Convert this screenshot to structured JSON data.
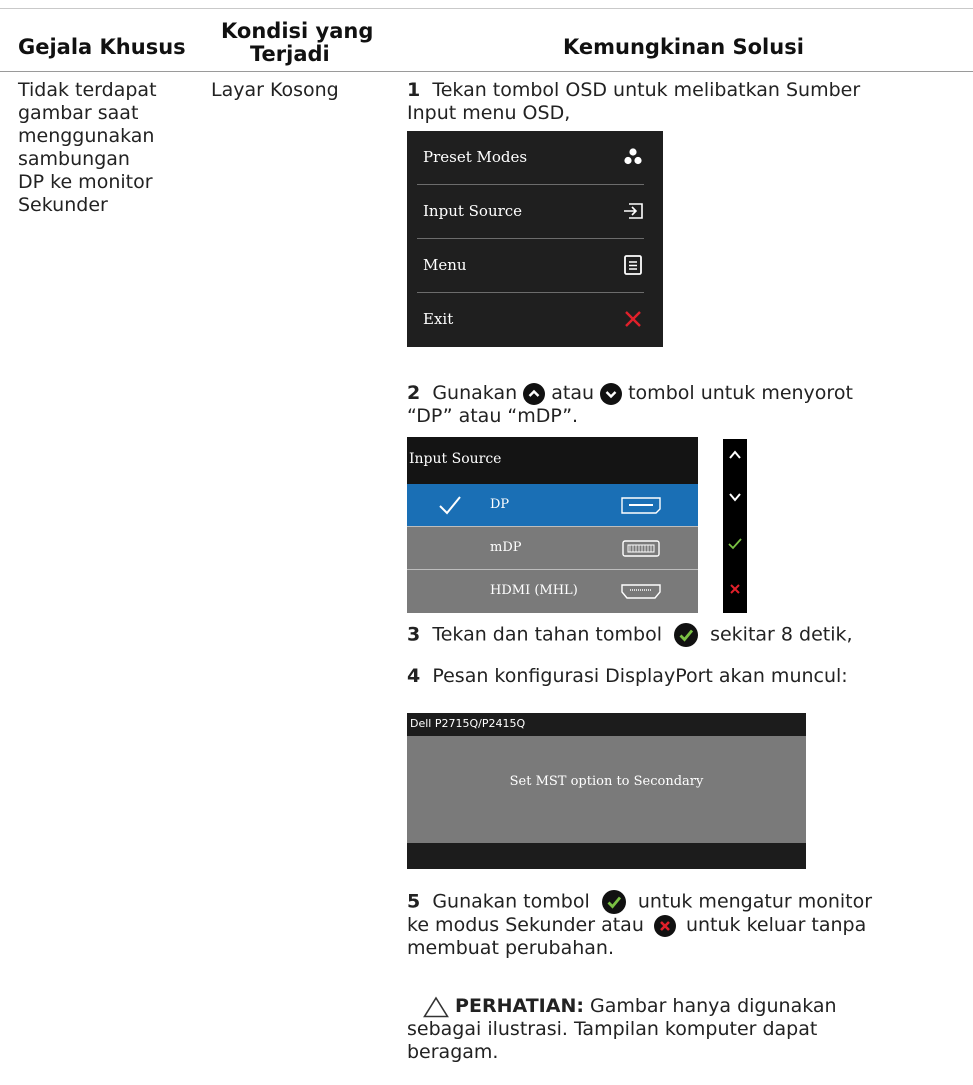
{
  "table_header": {
    "col1": "Gejala Khusus",
    "col2_line1": "Kondisi yang",
    "col2_line2": "Terjadi",
    "col3": "Kemungkinan Solusi"
  },
  "row": {
    "symptom_lines": [
      "Tidak terdapat",
      "gambar saat",
      "menggunakan",
      "sambungan",
      "DP ke monitor",
      "Sekunder"
    ],
    "condition": "Layar Kosong"
  },
  "steps": {
    "s1_num": "1",
    "s1_line1": "Tekan tombol OSD untuk melibatkan Sumber",
    "s1_line2": "Input menu OSD,",
    "s2_num": "2",
    "s2_a": "Gunakan",
    "s2_b": "atau",
    "s2_c": "tombol untuk menyorot",
    "s2_line2": "“DP” atau “mDP”.",
    "s3_num": "3",
    "s3_a": "Tekan dan tahan tombol",
    "s3_b": "sekitar 8 detik,",
    "s4_num": "4",
    "s4_text": "Pesan konfigurasi DisplayPort akan muncul:",
    "s5_num": "5",
    "s5_a": "Gunakan tombol",
    "s5_b": "untuk mengatur monitor",
    "s5_line2a": "ke modus Sekunder atau",
    "s5_line2b": "untuk keluar tanpa",
    "s5_line3": "membuat perubahan."
  },
  "caution": {
    "label": "PERHATIAN:",
    "line1": "Gambar hanya digunakan",
    "line2": "sebagai ilustrasi. Tampilan komputer dapat",
    "line3": "beragam."
  },
  "osd_menu": {
    "items": [
      "Preset Modes",
      "Input Source",
      "Menu",
      "Exit"
    ],
    "icons": [
      "preset-modes-icon",
      "input-source-icon",
      "menu-icon",
      "exit-x-icon"
    ]
  },
  "input_source_menu": {
    "title": "Input Source",
    "options": [
      "DP",
      "mDP",
      "HDMI (MHL)"
    ],
    "selected": "DP",
    "highlight_color": "#1a6fb5"
  },
  "dp_message": {
    "model": "Dell P2715Q/P2415Q",
    "message": "Set MST option to Secondary"
  },
  "colors": {
    "check_green": "#7ac043",
    "exit_red": "#e0202a"
  }
}
